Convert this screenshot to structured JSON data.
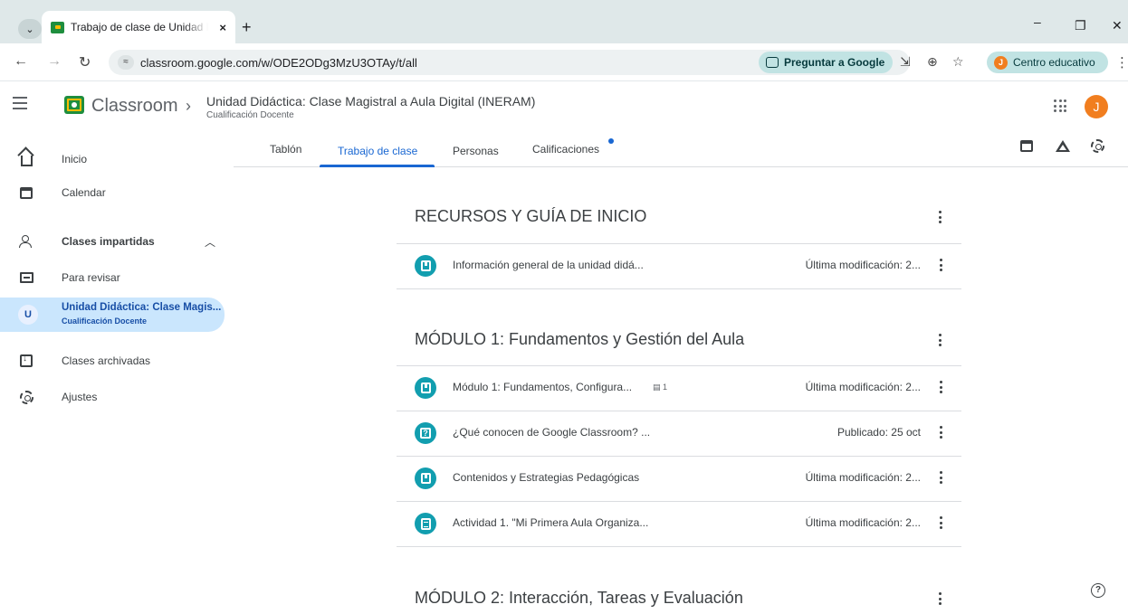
{
  "browser": {
    "tab_title": "Trabajo de clase de Unidad Didác",
    "tab_close": "×",
    "new_tab": "+",
    "url": "classroom.google.com/w/ODE2ODg3MzU3OTAy/t/all",
    "ask_google": "Preguntar a Google",
    "profile_label": "Centro educativo",
    "profile_initial": "J"
  },
  "header": {
    "brand": "Classroom",
    "course_title": "Unidad Didáctica: Clase Magistral a Aula Digital (INERAM)",
    "course_subtitle": "Cualificación Docente",
    "user_initial": "J"
  },
  "sidebar": {
    "items": [
      {
        "label": "Inicio",
        "icon": "home-icon"
      },
      {
        "label": "Calendar",
        "icon": "calendar-icon"
      },
      {
        "label": "Clases impartidas",
        "icon": "people-icon"
      },
      {
        "label": "Para revisar",
        "icon": "folder-icon"
      },
      {
        "label": "Unidad Didáctica: Clase Magis...",
        "sub": "Cualificación Docente",
        "avatar": "U"
      },
      {
        "label": "Clases archivadas",
        "icon": "archive-icon"
      },
      {
        "label": "Ajustes",
        "icon": "gear-icon"
      }
    ]
  },
  "tabs": [
    {
      "label": "Tablón"
    },
    {
      "label": "Trabajo de clase"
    },
    {
      "label": "Personas"
    },
    {
      "label": "Calificaciones"
    }
  ],
  "sections": [
    {
      "title": "RECURSOS Y GUÍA DE INICIO",
      "rows": [
        {
          "title": "Información general de la unidad didá...",
          "meta": "Última modificación: 2...",
          "type": "material"
        }
      ]
    },
    {
      "title": "MÓDULO 1: Fundamentos y Gestión del Aula",
      "rows": [
        {
          "title": "Módulo 1: Fundamentos, Configura...",
          "comments": "1",
          "meta": "Última modificación: 2...",
          "type": "material"
        },
        {
          "title": "¿Qué conocen de Google Classroom? ...",
          "meta": "Publicado: 25 oct",
          "type": "question"
        },
        {
          "title": "Contenidos y Estrategias Pedagógicas",
          "meta": "Última modificación: 2...",
          "type": "material"
        },
        {
          "title": "Actividad 1. \"Mi Primera Aula Organiza...",
          "meta": "Última modificación: 2...",
          "type": "assignment"
        }
      ]
    },
    {
      "title": "MÓDULO 2: Interacción, Tareas y Evaluación",
      "rows": []
    }
  ],
  "colors": {
    "accent": "#1967d2",
    "item_badge": "#129eaf",
    "active_nav": "#cae6fd"
  }
}
